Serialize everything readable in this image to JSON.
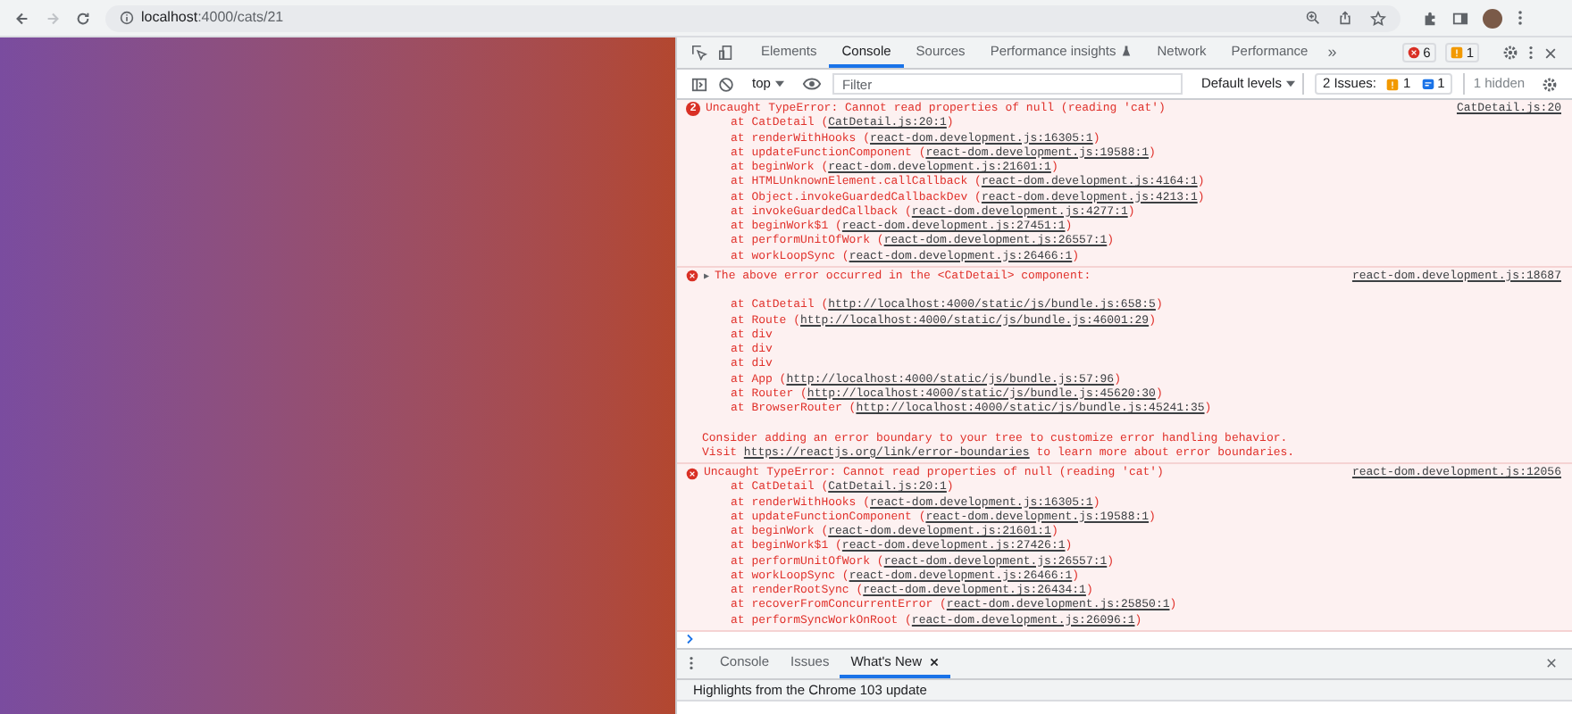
{
  "browser": {
    "url_host": "localhost",
    "url_path": ":4000/cats/21"
  },
  "devtools": {
    "tabs": [
      {
        "label": "Elements",
        "selected": false,
        "experimental": false
      },
      {
        "label": "Console",
        "selected": true,
        "experimental": false
      },
      {
        "label": "Sources",
        "selected": false,
        "experimental": false
      },
      {
        "label": "Performance insights",
        "selected": false,
        "experimental": true
      },
      {
        "label": "Network",
        "selected": false,
        "experimental": false
      },
      {
        "label": "Performance",
        "selected": false,
        "experimental": false
      }
    ],
    "more_tabs": "»",
    "error_count": "6",
    "warning_count": "1",
    "context": "top",
    "filter_placeholder": "Filter",
    "levels": "Default levels",
    "issues_label": "2 Issues:",
    "issues_warning": "1",
    "issues_info": "1",
    "hidden": "1 hidden"
  },
  "messages": [
    {
      "count": "2",
      "text": "Uncaught TypeError: Cannot read properties of null (reading 'cat')",
      "source": "CatDetail.js:20",
      "lines": [
        {
          "kind": "frame",
          "text": "at CatDetail (",
          "link": "CatDetail.js:20:1",
          "tail": ")"
        },
        {
          "kind": "frame",
          "text": "at renderWithHooks (",
          "link": "react-dom.development.js:16305:1",
          "tail": ")"
        },
        {
          "kind": "frame",
          "text": "at updateFunctionComponent (",
          "link": "react-dom.development.js:19588:1",
          "tail": ")"
        },
        {
          "kind": "frame",
          "text": "at beginWork (",
          "link": "react-dom.development.js:21601:1",
          "tail": ")"
        },
        {
          "kind": "frame",
          "text": "at HTMLUnknownElement.callCallback (",
          "link": "react-dom.development.js:4164:1",
          "tail": ")"
        },
        {
          "kind": "frame",
          "text": "at Object.invokeGuardedCallbackDev (",
          "link": "react-dom.development.js:4213:1",
          "tail": ")"
        },
        {
          "kind": "frame",
          "text": "at invokeGuardedCallback (",
          "link": "react-dom.development.js:4277:1",
          "tail": ")"
        },
        {
          "kind": "frame",
          "text": "at beginWork$1 (",
          "link": "react-dom.development.js:27451:1",
          "tail": ")"
        },
        {
          "kind": "frame",
          "text": "at performUnitOfWork (",
          "link": "react-dom.development.js:26557:1",
          "tail": ")"
        },
        {
          "kind": "frame",
          "text": "at workLoopSync (",
          "link": "react-dom.development.js:26466:1",
          "tail": ")"
        }
      ]
    },
    {
      "toggle": "▶",
      "text": "The above error occurred in the <CatDetail> component:",
      "source": "react-dom.development.js:18687",
      "lines": [
        {
          "kind": "blank"
        },
        {
          "kind": "frame",
          "text": "at CatDetail (",
          "link": "http://localhost:4000/static/js/bundle.js:658:5",
          "tail": ")"
        },
        {
          "kind": "frame",
          "text": "at Route (",
          "link": "http://localhost:4000/static/js/bundle.js:46001:29",
          "tail": ")"
        },
        {
          "kind": "frame",
          "text": "at div"
        },
        {
          "kind": "frame",
          "text": "at div"
        },
        {
          "kind": "frame",
          "text": "at div"
        },
        {
          "kind": "frame",
          "text": "at App (",
          "link": "http://localhost:4000/static/js/bundle.js:57:96",
          "tail": ")"
        },
        {
          "kind": "frame",
          "text": "at Router (",
          "link": "http://localhost:4000/static/js/bundle.js:45620:30",
          "tail": ")"
        },
        {
          "kind": "frame",
          "text": "at BrowserRouter (",
          "link": "http://localhost:4000/static/js/bundle.js:45241:35",
          "tail": ")"
        },
        {
          "kind": "blank"
        },
        {
          "kind": "note",
          "text": "Consider adding an error boundary to your tree to customize error handling behavior."
        },
        {
          "kind": "note",
          "text": "Visit ",
          "link": "https://reactjs.org/link/error-boundaries",
          "tail": " to learn more about error boundaries."
        }
      ]
    },
    {
      "text": "Uncaught TypeError: Cannot read properties of null (reading 'cat')",
      "source": "react-dom.development.js:12056",
      "lines": [
        {
          "kind": "frame",
          "text": "at CatDetail (",
          "link": "CatDetail.js:20:1",
          "tail": ")"
        },
        {
          "kind": "frame",
          "text": "at renderWithHooks (",
          "link": "react-dom.development.js:16305:1",
          "tail": ")"
        },
        {
          "kind": "frame",
          "text": "at updateFunctionComponent (",
          "link": "react-dom.development.js:19588:1",
          "tail": ")"
        },
        {
          "kind": "frame",
          "text": "at beginWork (",
          "link": "react-dom.development.js:21601:1",
          "tail": ")"
        },
        {
          "kind": "frame",
          "text": "at beginWork$1 (",
          "link": "react-dom.development.js:27426:1",
          "tail": ")"
        },
        {
          "kind": "frame",
          "text": "at performUnitOfWork (",
          "link": "react-dom.development.js:26557:1",
          "tail": ")"
        },
        {
          "kind": "frame",
          "text": "at workLoopSync (",
          "link": "react-dom.development.js:26466:1",
          "tail": ")"
        },
        {
          "kind": "frame",
          "text": "at renderRootSync (",
          "link": "react-dom.development.js:26434:1",
          "tail": ")"
        },
        {
          "kind": "frame",
          "text": "at recoverFromConcurrentError (",
          "link": "react-dom.development.js:25850:1",
          "tail": ")"
        },
        {
          "kind": "frame",
          "text": "at performSyncWorkOnRoot (",
          "link": "react-dom.development.js:26096:1",
          "tail": ")"
        }
      ]
    }
  ],
  "drawer": {
    "tabs": [
      {
        "label": "Console",
        "selected": false,
        "closable": false
      },
      {
        "label": "Issues",
        "selected": false,
        "closable": false
      },
      {
        "label": "What's New",
        "selected": true,
        "closable": true
      }
    ],
    "headline": "Highlights from the Chrome 103 update"
  }
}
